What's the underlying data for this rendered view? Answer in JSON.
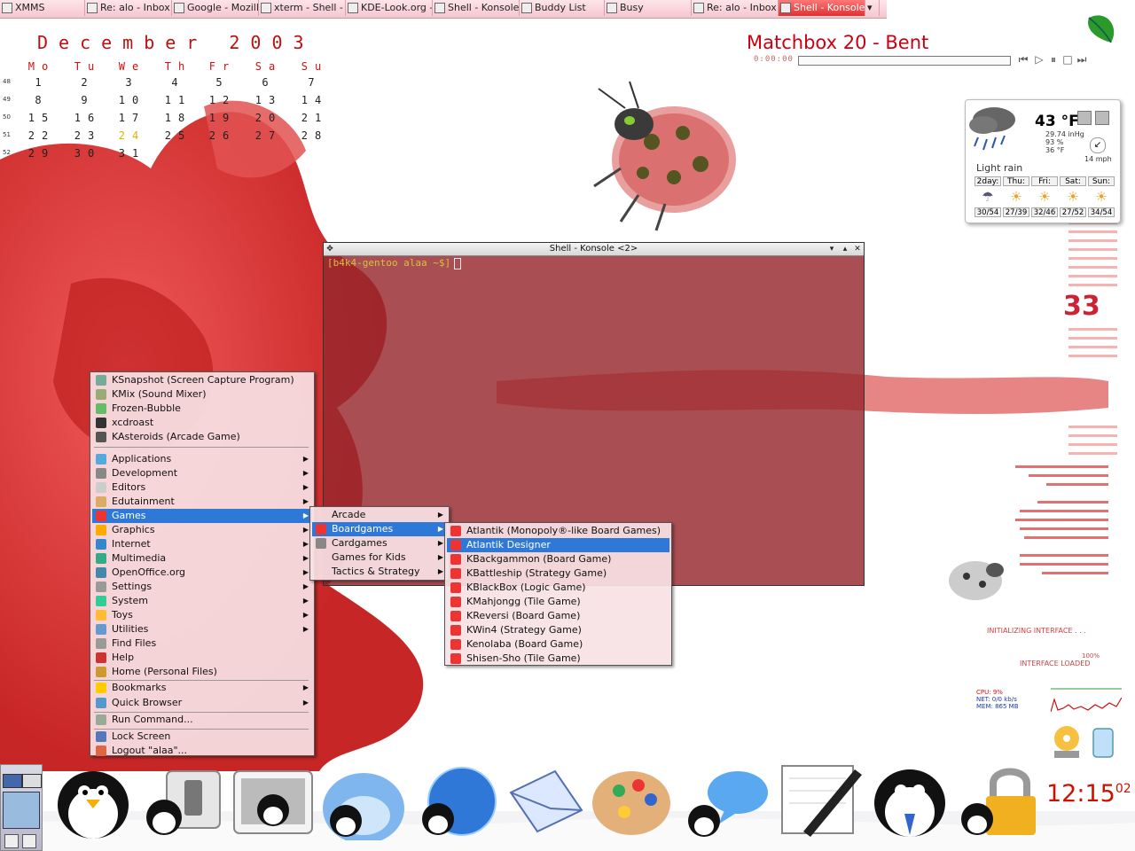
{
  "taskbar": {
    "tasks": [
      {
        "label": "XMMS"
      },
      {
        "label": "Re: alo - Inbox f"
      },
      {
        "label": "Google - Mozilla"
      },
      {
        "label": "xterm - Shell - K"
      },
      {
        "label": "KDE-Look.org -"
      },
      {
        "label": "Shell - Konsole"
      },
      {
        "label": "Buddy List"
      },
      {
        "label": "Busy"
      },
      {
        "label": "Re: alo - Inbox f"
      },
      {
        "label": "Shell - Konsole"
      }
    ],
    "active_index": 9,
    "arrow": "▾"
  },
  "calendar": {
    "title": "December 2003",
    "weekdays": [
      "Mo",
      "Tu",
      "We",
      "Th",
      "Fr",
      "Sa",
      "Su"
    ],
    "weeks": [
      {
        "num": "48",
        "days": [
          "",
          "1",
          "2",
          "3",
          "4",
          "5",
          "6",
          "7"
        ]
      },
      {
        "num": "49",
        "days": [
          "",
          "8",
          "9",
          "10",
          "11",
          "12",
          "13",
          "14"
        ]
      },
      {
        "num": "50",
        "days": [
          "",
          "15",
          "16",
          "17",
          "18",
          "19",
          "20",
          "21"
        ]
      },
      {
        "num": "51",
        "days": [
          "",
          "22",
          "23",
          "24",
          "25",
          "26",
          "27",
          "28"
        ]
      },
      {
        "num": "52",
        "days": [
          "",
          "29",
          "30",
          "31",
          "",
          "",
          "",
          ""
        ]
      }
    ],
    "today": "24"
  },
  "matchbox": {
    "title": "Matchbox 20 - Bent",
    "time": "0:00:00",
    "controls": [
      "prev-icon",
      "play-icon",
      "pause-icon",
      "stop-icon",
      "next-icon"
    ],
    "progress": 0
  },
  "weather": {
    "temp": "43 °F",
    "pressure": "29.74 inHg",
    "humidity": "93 %",
    "dewpoint": "36 °F",
    "wind": "14 mph",
    "condition": "Light rain",
    "days": [
      "2day:",
      "Thu:",
      "Fri:",
      "Sat:",
      "Sun:"
    ],
    "temps": [
      "30/54",
      "27/39",
      "32/46",
      "27/52",
      "34/54"
    ]
  },
  "konsole": {
    "title": "Shell - Konsole <2>",
    "prompt": "[b4k4-gentoo alaa ~$]"
  },
  "kmenu": {
    "recent": [
      {
        "label": "KSnapshot (Screen Capture Program)",
        "icon": "camera-icon"
      },
      {
        "label": "KMix (Sound Mixer)",
        "icon": "speaker-icon"
      },
      {
        "label": "Frozen-Bubble",
        "icon": "bubble-icon"
      },
      {
        "label": "xcdroast",
        "icon": "cd-icon"
      },
      {
        "label": "KAsteroids (Arcade Game)",
        "icon": "asteroid-icon"
      }
    ],
    "categories": [
      {
        "label": "Applications",
        "icon": "apps-icon",
        "submenu": true
      },
      {
        "label": "Development",
        "icon": "dev-icon",
        "submenu": true
      },
      {
        "label": "Editors",
        "icon": "editor-icon",
        "submenu": true
      },
      {
        "label": "Edutainment",
        "icon": "edu-icon",
        "submenu": true
      },
      {
        "label": "Games",
        "icon": "games-icon",
        "submenu": true
      },
      {
        "label": "Graphics",
        "icon": "graphics-icon",
        "submenu": true
      },
      {
        "label": "Internet",
        "icon": "internet-icon",
        "submenu": true
      },
      {
        "label": "Multimedia",
        "icon": "multimedia-icon",
        "submenu": true
      },
      {
        "label": "OpenOffice.org",
        "icon": "office-icon",
        "submenu": true
      },
      {
        "label": "Settings",
        "icon": "settings-icon",
        "submenu": true
      },
      {
        "label": "System",
        "icon": "system-icon",
        "submenu": true
      },
      {
        "label": "Toys",
        "icon": "toys-icon",
        "submenu": true
      },
      {
        "label": "Utilities",
        "icon": "utilities-icon",
        "submenu": true
      },
      {
        "label": "Find Files",
        "icon": "find-icon",
        "submenu": false
      },
      {
        "label": "Help",
        "icon": "help-icon",
        "submenu": false
      },
      {
        "label": "Home (Personal Files)",
        "icon": "home-icon",
        "submenu": false
      }
    ],
    "places": [
      {
        "label": "Bookmarks",
        "icon": "bookmark-icon",
        "submenu": true
      },
      {
        "label": "Quick Browser",
        "icon": "browser-icon",
        "submenu": true
      }
    ],
    "run": {
      "label": "Run Command...",
      "icon": "run-icon"
    },
    "session": [
      {
        "label": "Lock Screen",
        "icon": "lock-icon"
      },
      {
        "label": "Logout \"alaa\"...",
        "icon": "logout-icon"
      }
    ],
    "highlighted": "Games"
  },
  "games_menu": {
    "items": [
      "Arcade",
      "Boardgames",
      "Cardgames",
      "Games for Kids",
      "Tactics & Strategy"
    ],
    "highlighted": "Boardgames"
  },
  "boardgames_menu": {
    "items": [
      "Atlantik (Monopoly®-like Board Games)",
      "Atlantik Designer",
      "KBackgammon (Board Game)",
      "KBattleship (Strategy Game)",
      "KBlackBox (Logic Game)",
      "KMahjongg (Tile Game)",
      "KReversi (Board Game)",
      "KWin4 (Strategy Game)",
      "Kenolaba (Board Game)",
      "Shisen-Sho (Tile Game)"
    ],
    "highlighted": "Atlantik Designer"
  },
  "sysmon": {
    "cpu": "CPU: 9%",
    "net": "NET: 0/0 kb/s",
    "mem": "MEM: 865 MB"
  },
  "deco_text": {
    "init": "INITIALIZING INTERFACE . . .",
    "pct": "100%",
    "loaded": "INTERFACE LOADED",
    "big_number": "33"
  },
  "clock": {
    "time": "12:15",
    "seconds": "02"
  },
  "colors": {
    "accent": "#cc1122",
    "highlight": "#2e79d8",
    "konsole_bg": "#962830"
  }
}
